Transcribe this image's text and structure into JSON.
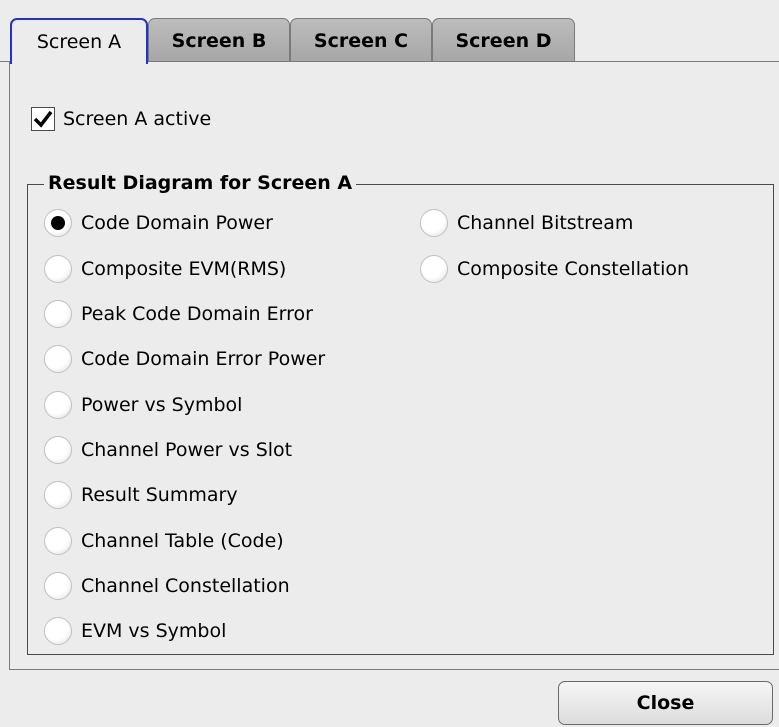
{
  "tabs": [
    {
      "label": "Screen A",
      "active": true
    },
    {
      "label": "Screen B",
      "active": false
    },
    {
      "label": "Screen C",
      "active": false
    },
    {
      "label": "Screen D",
      "active": false
    }
  ],
  "screen_active": {
    "label": "Screen A active",
    "checked": true
  },
  "group": {
    "title": "Result Diagram for Screen A",
    "options": [
      {
        "label": "Code Domain Power",
        "selected": true
      },
      {
        "label": "Composite EVM(RMS)",
        "selected": false
      },
      {
        "label": "Peak Code Domain Error",
        "selected": false
      },
      {
        "label": "Code Domain Error Power",
        "selected": false
      },
      {
        "label": "Power vs Symbol",
        "selected": false
      },
      {
        "label": "Channel Power vs Slot",
        "selected": false
      },
      {
        "label": "Result Summary",
        "selected": false
      },
      {
        "label": "Channel Table (Code)",
        "selected": false
      },
      {
        "label": "Channel Constellation",
        "selected": false
      },
      {
        "label": "EVM vs Symbol",
        "selected": false
      },
      {
        "label": "Channel Bitstream",
        "selected": false
      },
      {
        "label": "Composite Constellation",
        "selected": false
      }
    ]
  },
  "close_label": "Close",
  "colors": {
    "active_tab_border": "#2233cc",
    "background": "#ececec",
    "selected_dot": "#000000"
  }
}
